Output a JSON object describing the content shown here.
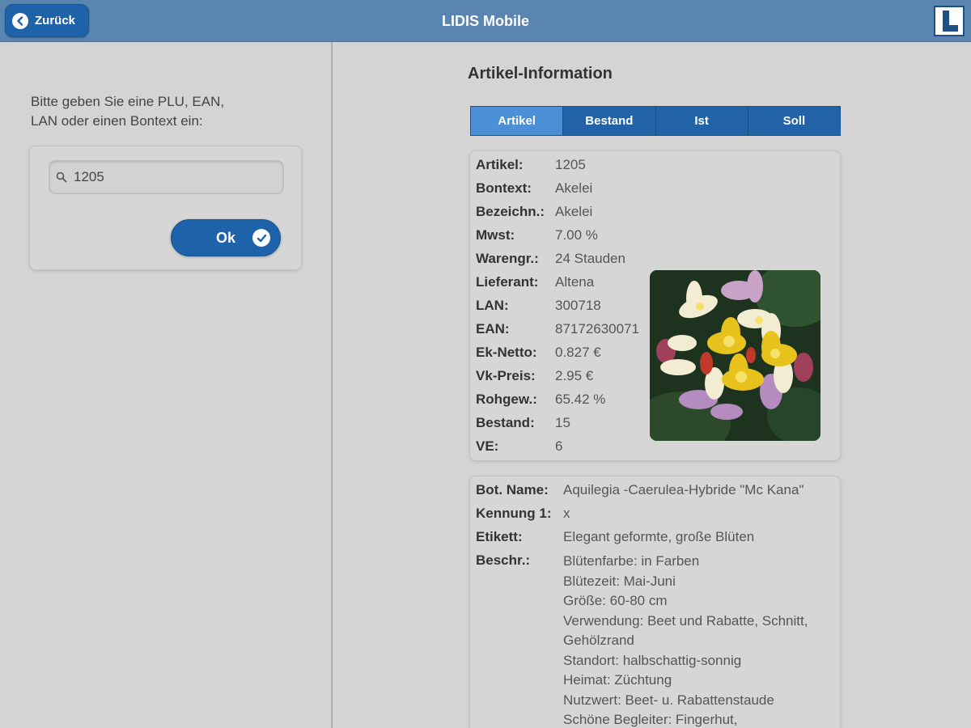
{
  "header": {
    "back_label": "Zurück",
    "title": "LIDIS Mobile",
    "logo_icon": "lidis-logo"
  },
  "search": {
    "prompt_line1": "Bitte geben Sie eine PLU, EAN,",
    "prompt_line2": "LAN oder einen Bontext ein:",
    "value": "1205",
    "ok_label": "Ok"
  },
  "info": {
    "title": "Artikel-Information",
    "tabs": [
      {
        "label": "Artikel",
        "active": true
      },
      {
        "label": "Bestand",
        "active": false
      },
      {
        "label": "Ist",
        "active": false
      },
      {
        "label": "Soll",
        "active": false
      }
    ],
    "fields": [
      {
        "key": "Artikel:",
        "value": "1205"
      },
      {
        "key": "Bontext:",
        "value": "Akelei"
      },
      {
        "key": "Bezeichn.:",
        "value": "Akelei"
      },
      {
        "key": "Mwst:",
        "value": "7.00 %"
      },
      {
        "key": "Warengr.:",
        "value": "24 Stauden"
      },
      {
        "key": "Lieferant:",
        "value": "Altena"
      },
      {
        "key": "LAN:",
        "value": "300718"
      },
      {
        "key": "EAN:",
        "value": "87172630071"
      },
      {
        "key": "Ek-Netto:",
        "value": "0.827 €"
      },
      {
        "key": "Vk-Preis:",
        "value": "2.95 €"
      },
      {
        "key": "Rohgew.:",
        "value": "65.42 %"
      },
      {
        "key": "Bestand:",
        "value": "15"
      },
      {
        "key": "VE:",
        "value": "6"
      }
    ],
    "details": {
      "bot_name_key": "Bot. Name:",
      "bot_name_value": "Aquilegia -Caerulea-Hybride \"Mc Kana\"",
      "kennung_key": "Kennung 1:",
      "kennung_value": "x",
      "etikett_key": "Etikett:",
      "etikett_value": "Elegant geformte, große Blüten",
      "beschr_key": "Beschr.:",
      "beschr_lines": [
        "Blütenfarbe: in Farben",
        "Blütezeit: Mai-Juni",
        "Größe: 60-80 cm",
        "Verwendung: Beet und Rabatte, Schnitt,",
        "Gehölzrand",
        "Standort: halbschattig-sonnig",
        "Heimat: Züchtung",
        "Nutzwert: Beet- u. Rabattenstaude",
        "Schöne Begleiter: Fingerhut,"
      ]
    }
  }
}
